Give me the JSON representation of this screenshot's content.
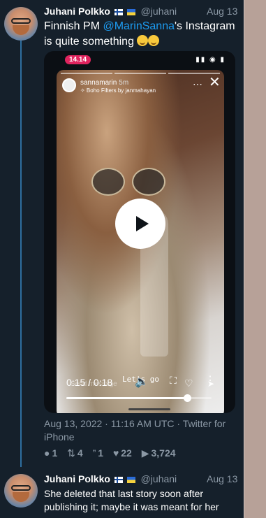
{
  "tweet1": {
    "name": "Juhani Polkko",
    "handle": "@juhani",
    "date": "Aug 13",
    "text_before": "Finnish PM ",
    "mention": "@MarinSanna",
    "text_after": "'s Instagram is quite something "
  },
  "media": {
    "phone_time": "14.14",
    "phone_status_icons": "▮▮ ◉ ▮",
    "story_user": "sannamarin",
    "story_age": "5m",
    "story_filter": "✧ Boho Filters by janmahayan",
    "story_caption": "Let's go",
    "send_message_placeholder": "Send message",
    "timecode": "0:15 / 0:18",
    "progress_fraction": 0.833
  },
  "meta": {
    "timestamp": "Aug 13, 2022 · 11:16 AM UTC · Twitter for iPhone"
  },
  "stats": {
    "replies": "1",
    "retweets": "4",
    "quotes": "1",
    "likes": "22",
    "views": "3,724"
  },
  "tweet2": {
    "name": "Juhani Polkko",
    "handle": "@juhani",
    "date": "Aug 13",
    "text": "She deleted that last story soon after publishing it; maybe it was meant for her"
  },
  "colors": {
    "background": "#15202b",
    "accent": "#1d9bf0",
    "muted": "#8b98a5",
    "thread_line": "#2f6fa0"
  }
}
